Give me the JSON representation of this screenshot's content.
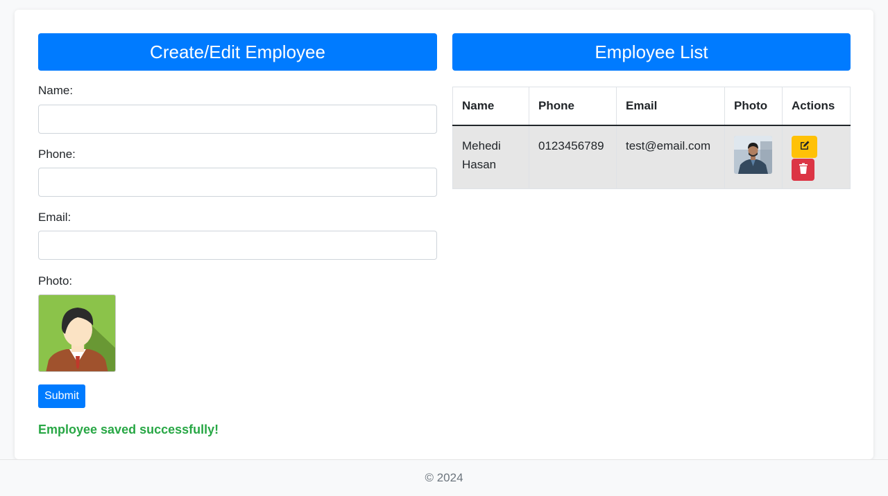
{
  "form": {
    "title": "Create/Edit Employee",
    "name_label": "Name:",
    "name_value": "",
    "phone_label": "Phone:",
    "phone_value": "",
    "email_label": "Email:",
    "email_value": "",
    "photo_label": "Photo:",
    "photo_icon": "default-avatar-icon",
    "submit_label": "Submit",
    "status_message": "Employee saved successfully!"
  },
  "list": {
    "title": "Employee List",
    "columns": [
      "Name",
      "Phone",
      "Email",
      "Photo",
      "Actions"
    ],
    "rows": [
      {
        "name_line1": "Mehedi",
        "name_line2": "Hasan",
        "phone": "0123456789",
        "email": "test@email.com",
        "photo": "employee-photo",
        "edit_icon": "edit-icon",
        "delete_icon": "trash-icon"
      }
    ]
  },
  "footer": {
    "text": "© 2024"
  },
  "colors": {
    "primary": "#007bff",
    "success": "#28a745",
    "warning": "#ffc107",
    "danger": "#dc3545"
  }
}
